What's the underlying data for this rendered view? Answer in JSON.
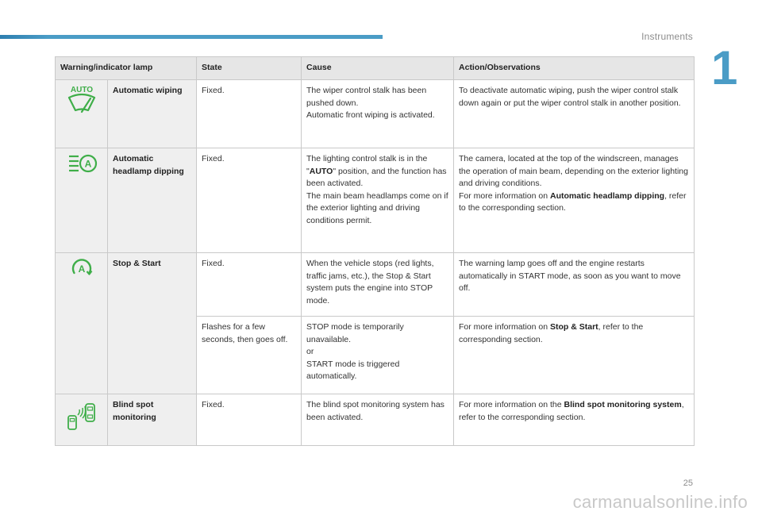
{
  "header": {
    "section_title": "Instruments",
    "chapter_number": "1"
  },
  "footer": {
    "page_number": "25",
    "watermark": "carmanualsonline.info"
  },
  "colors": {
    "accent": "#4a9cc6",
    "icon_green": "#3fae49",
    "table_header_bg": "#e6e6e6",
    "table_label_bg": "#efefef"
  },
  "table": {
    "headers": [
      "Warning/indicator lamp",
      "State",
      "Cause",
      "Action/Observations"
    ],
    "rows": [
      {
        "icon": "automatic-wiping-icon",
        "icon_text": "AUTO",
        "name": "Automatic wiping",
        "state": "Fixed.",
        "cause": [
          "The wiper control stalk has been pushed down.",
          "Automatic front wiping is activated."
        ],
        "action": "To deactivate automatic wiping, push the wiper control stalk down again or put the wiper control stalk in another position."
      },
      {
        "icon": "automatic-headlamp-dipping-icon",
        "icon_text": "A",
        "name": "Automatic headlamp dipping",
        "state": "Fixed.",
        "cause_pre": "The lighting control stalk is in the \"",
        "cause_bold": "AUTO",
        "cause_post": "\" position, and the function has been activated.",
        "cause_2": "The main beam headlamps come on if the exterior lighting and driving conditions permit.",
        "action_1": "The camera, located at the top of the windscreen, manages the operation of main beam, depending on the exterior lighting and driving conditions.",
        "action_2_pre": "For more information on ",
        "action_2_bold": "Automatic headlamp dipping",
        "action_2_post": ", refer to the corresponding section."
      },
      {
        "icon": "stop-and-start-icon",
        "icon_text": "A",
        "name": "Stop & Start",
        "state": "Fixed.",
        "cause": "When the vehicle stops (red lights, traffic jams, etc.), the Stop & Start system puts the engine into STOP mode.",
        "action": "The warning lamp goes off and the engine restarts automatically in START mode, as soon as you want to move off."
      },
      {
        "state": "Flashes for a few seconds, then goes off.",
        "cause": [
          "STOP mode is temporarily unavailable.",
          "or",
          "START mode is triggered automatically."
        ],
        "action_pre": "For more information on ",
        "action_bold": "Stop & Start",
        "action_post": ", refer to the corresponding section."
      },
      {
        "icon": "blind-spot-monitoring-icon",
        "name": "Blind spot monitoring",
        "state": "Fixed.",
        "cause": "The blind spot monitoring system has been activated.",
        "action_pre": "For more information on the ",
        "action_bold": "Blind spot monitoring system",
        "action_post": ", refer to the corresponding section."
      }
    ]
  }
}
